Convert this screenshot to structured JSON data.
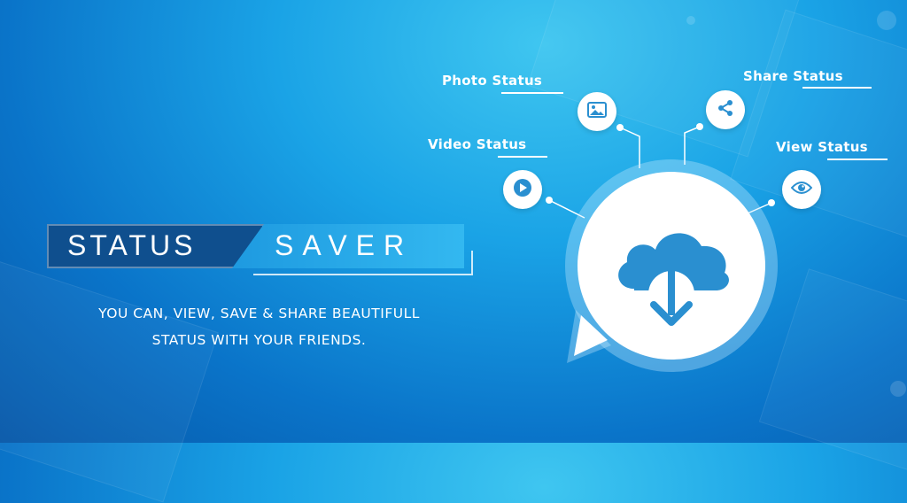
{
  "title": {
    "word1": "STATUS",
    "word2": "SAVER"
  },
  "tagline": {
    "line1": "YOU CAN, VIEW, SAVE & SHARE BEAUTIFULL",
    "line2": "STATUS WITH YOUR FRIENDS."
  },
  "features": {
    "photo": "Photo Status",
    "share": "Share Status",
    "video": "Video Status",
    "view": "View Status"
  },
  "icons": {
    "photo": "image-icon",
    "share": "share-icon",
    "video": "play-icon",
    "view": "eye-icon",
    "center": "cloud-download-icon"
  },
  "colors": {
    "accent": "#1e8fd8",
    "icon": "#2a8fd0",
    "background": "#1aa3e6"
  }
}
